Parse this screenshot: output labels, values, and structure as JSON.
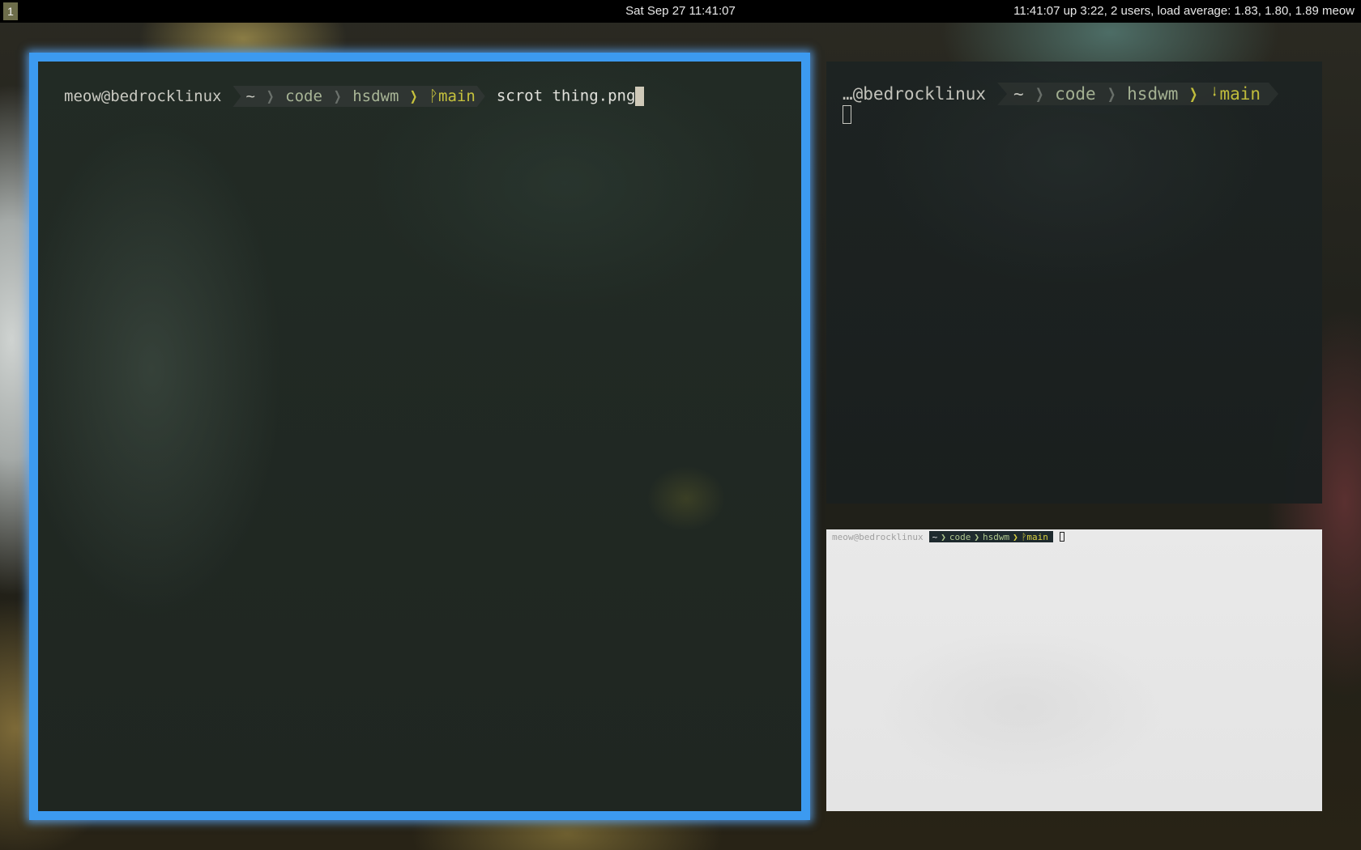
{
  "topbar": {
    "tag": "1",
    "clock": "Sat Sep 27 11:41:07",
    "status": "11:41:07 up  3:22,  2 users,  load average: 1.83, 1.80, 1.89  meow"
  },
  "terminals": {
    "main": {
      "user": "meow@bedrocklinux",
      "path": [
        "~",
        "code",
        "hsdwm"
      ],
      "branch": "main",
      "git_glyph": "ᚹ",
      "command": "scrot thing.png"
    },
    "top_right": {
      "user": "…@bedrocklinux",
      "path": [
        "~",
        "code",
        "hsdwm"
      ],
      "branch": "main",
      "git_glyph": "ᛍ"
    },
    "bottom_right": {
      "user": "meow@bedrocklinux",
      "path": [
        "~",
        "code",
        "hsdwm"
      ],
      "branch": "main",
      "git_glyph": "ᚹ"
    }
  },
  "colors": {
    "focus_border": "#3c9af0",
    "branch": "#c6c23d",
    "path": "#a8b596"
  }
}
